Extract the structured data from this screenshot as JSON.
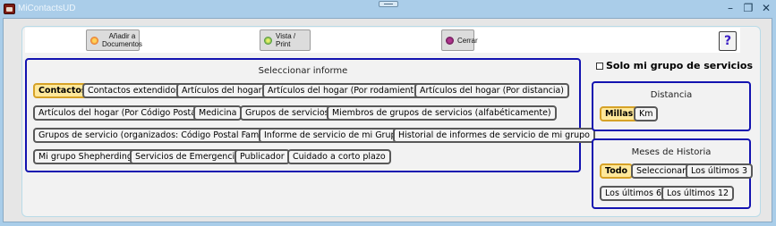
{
  "window": {
    "title": "MiContactsUD"
  },
  "toolbar": {
    "add_doc_label_1": "Añadir a",
    "add_doc_label_2": "Documentos",
    "print_label": "Vista / Print",
    "close_label": "Cerrar",
    "help_label": "?"
  },
  "report": {
    "title": "Seleccionar informe",
    "items": [
      "Contactos",
      "Contactos extendidos",
      "Artículos del hogar",
      "Artículos del hogar (Por rodamiento)",
      "Artículos del hogar (Por distancia)",
      "Artículos del hogar (Por Código Postal)",
      "Medicina",
      "Grupos de servicios",
      "Miembros de grupos de servicios (alfabéticamente)",
      "Grupos de servicio (organizados: Código Postal Familiar)",
      "Informe de servicio de mi Grupo",
      "Historial de informes de servicio de mi grupo",
      "Mi grupo Shepherding",
      "Servicios de Emergencia",
      "Publicador",
      "Cuidado a corto plazo"
    ],
    "selected": "Contactos"
  },
  "only_my_group": {
    "label": "Solo mi grupo de servicios",
    "checked": false
  },
  "distance": {
    "title": "Distancia",
    "options": [
      "Millas",
      "Km"
    ],
    "selected": "Millas"
  },
  "history": {
    "title": "Meses de Historia",
    "options": [
      "Todo",
      "Seleccionar",
      "Los últimos 3",
      "Los últimos 6",
      "Los últimos 12"
    ],
    "selected": "Todo"
  },
  "colors": {
    "accent_border": "#1313b0",
    "selected_bg": "#ffe89a",
    "selected_border": "#d6a227"
  }
}
